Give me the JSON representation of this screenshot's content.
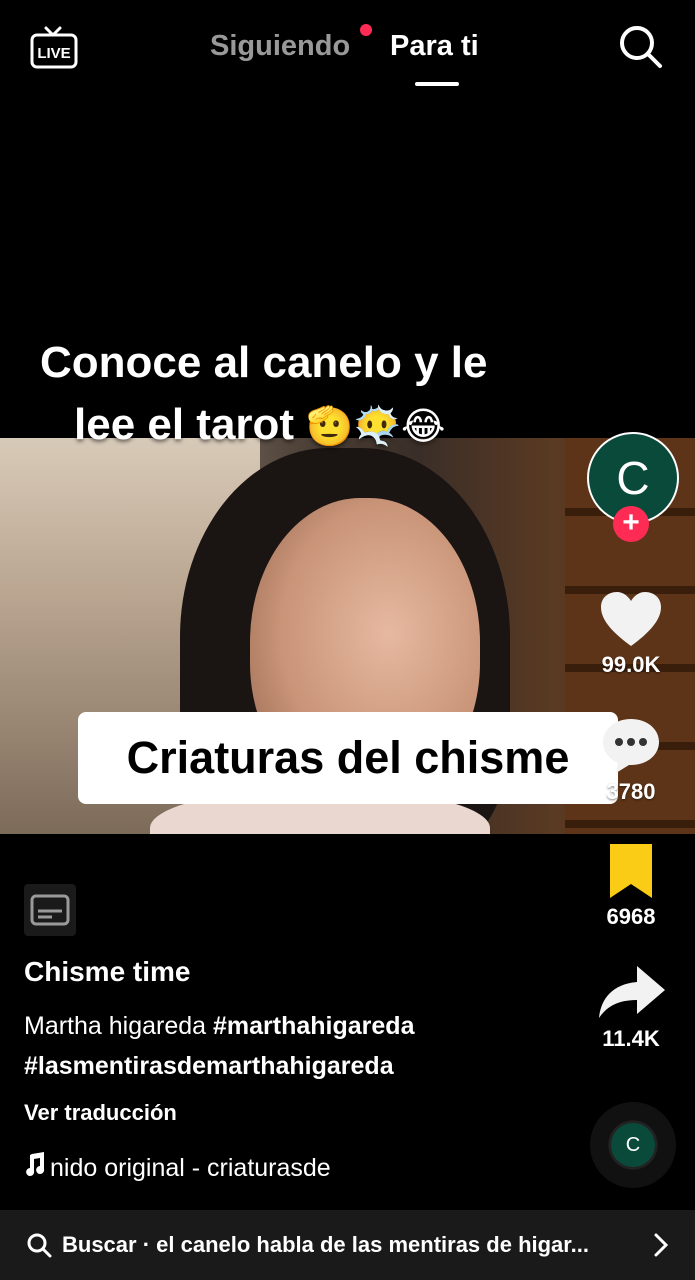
{
  "topbar": {
    "live_label": "LIVE",
    "tab_following": "Siguiendo",
    "tab_foryou": "Para ti"
  },
  "video": {
    "overlay_line1": "Conoce al canelo y le",
    "overlay_line2": "lee el tarot",
    "overlay_emojis": "🫡😶‍🌫️😂",
    "caption_box": "Criaturas del chisme"
  },
  "rail": {
    "avatar_letter": "C",
    "follow_symbol": "+",
    "likes": "99.0K",
    "comments": "3780",
    "saves": "6968",
    "shares": "11.4K"
  },
  "post": {
    "author": "Chisme time",
    "desc_text": "Martha higareda ",
    "hashtag1": "#marthahigareda",
    "hashtag2": "#lasmentirasdemarthahigareda",
    "translate": "Ver traducción",
    "music": "nido original - criaturasde",
    "disc_letter": "C"
  },
  "search": {
    "text": "Buscar · el canelo habla de las mentiras de higar..."
  },
  "colors": {
    "accent": "#fe2c55",
    "save_yellow": "#facc15",
    "avatar_green": "#0a4a3a"
  }
}
